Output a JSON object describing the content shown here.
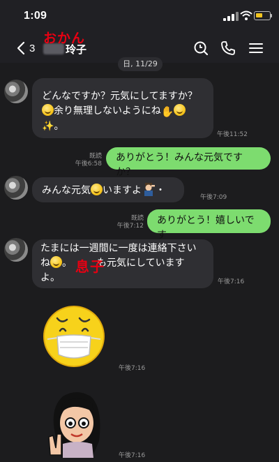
{
  "status_bar": {
    "time": "1:09"
  },
  "header": {
    "back_count": "3",
    "contact_name_suffix": "玲子",
    "annotation": "おかん"
  },
  "date_divider": "日, 11/29",
  "messages": [
    {
      "side": "left",
      "lines": [
        "どんなですか？元気にしてますか？",
        "余り無理しないようにね",
        "。"
      ],
      "time": "午後11:52"
    },
    {
      "side": "right",
      "text": "ありがとう！みんな元気ですか？",
      "read": "既読",
      "time": "午後6:58"
    },
    {
      "side": "left",
      "text": "みんな元気",
      "text2": "いますよ",
      "text3": "・",
      "time": "午後7:09"
    },
    {
      "side": "right",
      "text": "ありがとう！嬉しいです",
      "read": "既読",
      "time": "午後7:12"
    },
    {
      "side": "left",
      "line1": "たまには一週間に一度は連絡下さい",
      "line2a": "ね",
      "line2b": "。",
      "line2c": "も元気にしています",
      "line3": "よ。",
      "time": "午後7:16"
    },
    {
      "side": "left",
      "sticker": "mask-face-sticker",
      "time": "午後7:16"
    },
    {
      "side": "left",
      "sticker": "peace-girl-sticker",
      "time": "午後7:16"
    }
  ],
  "annotation_musuko": "息子",
  "colors": {
    "outgoing_bubble": "#7ddc6f",
    "incoming_bubble": "#2f2f33",
    "annotation": "#e60012",
    "background": "#1c1c1e"
  }
}
